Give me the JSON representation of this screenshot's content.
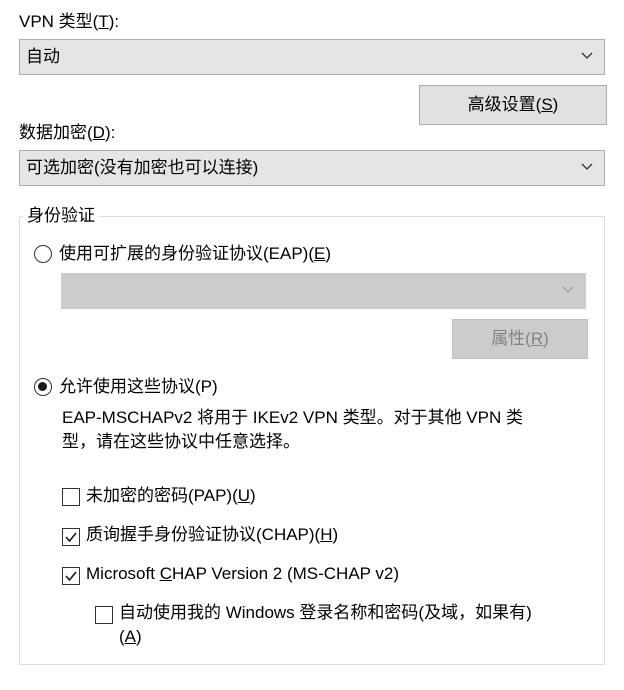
{
  "vpn_type": {
    "label": "VPN 类型(",
    "mnemonic": "T",
    "suffix": "):",
    "value": "自动"
  },
  "advanced_button": {
    "label": "高级设置(",
    "mnemonic": "S",
    "suffix": ")"
  },
  "encryption": {
    "label": "数据加密(",
    "mnemonic": "D",
    "suffix": "):",
    "value": "可选加密(没有加密也可以连接)"
  },
  "auth": {
    "group_title": "身份验证",
    "eap_radio": {
      "label": "使用可扩展的身份验证协议(EAP)(",
      "mnemonic": "E",
      "suffix": ")",
      "selected": false
    },
    "eap_combo_value": "",
    "properties_button": {
      "label": "属性(",
      "mnemonic": "R",
      "suffix": ")",
      "disabled": true
    },
    "allow_radio": {
      "label": "允许使用这些协议(P)",
      "selected": true
    },
    "note_line1": "EAP-MSCHAPv2 将用于 IKEv2 VPN 类型。对于其他 VPN 类",
    "note_line2": "型，请在这些协议中任意选择。",
    "pap": {
      "label": "未加密的密码(PAP)(",
      "mnemonic": "U",
      "suffix": ")",
      "checked": false
    },
    "chap": {
      "label": "质询握手身份验证协议(CHAP)(",
      "mnemonic": "H",
      "suffix": ")",
      "checked": true
    },
    "mschap": {
      "prefix": "Microsoft ",
      "mnemonic": "C",
      "label": "HAP Version 2 (MS-CHAP v2)",
      "checked": true
    },
    "auto_windows": {
      "line1": "自动使用我的 Windows 登录名称和密码(及域，如果有)",
      "line2_prefix": "(",
      "mnemonic": "A",
      "line2_suffix": ")",
      "checked": false
    }
  },
  "icons": {
    "chevron": "chevron-down-icon",
    "check": "checkmark-icon"
  },
  "colors": {
    "combo_bg": "#e5e5e5",
    "button_bg": "#e1e1e1",
    "disabled_bg": "#cccccc",
    "disabled_text": "#838383"
  }
}
